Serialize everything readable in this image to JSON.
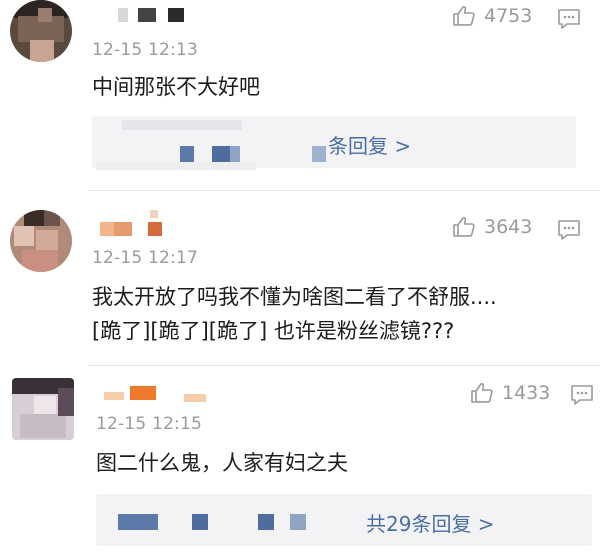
{
  "comments": [
    {
      "time": "12-15 12:13",
      "likes": "4753",
      "text": [
        "中间那张不大好吧"
      ],
      "replies": {
        "label": "条回复 >"
      }
    },
    {
      "time": "12-15 12:17",
      "likes": "3643",
      "text": [
        "我太开放了吗我不懂为啥图二看了不舒服....",
        "[跪了][跪了][跪了] 也许是粉丝滤镜???"
      ]
    },
    {
      "time": "12-15 12:15",
      "likes": "1433",
      "text": [
        "图二什么鬼，人家有妇之夫"
      ],
      "replies": {
        "label": "共29条回复 >"
      }
    }
  ],
  "icons": {
    "like": "thumbs-up-icon",
    "reply": "reply-bubble-icon"
  },
  "colors": {
    "link": "#4a6fa5",
    "muted": "#9a9a9a",
    "reply_bg": "#f3f3f5"
  }
}
